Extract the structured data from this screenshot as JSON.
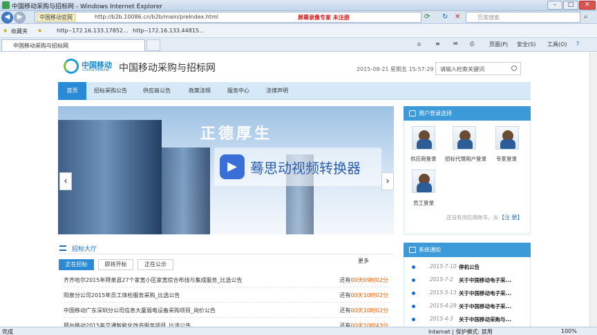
{
  "window": {
    "title": "中国移动采购与招标网 - Windows Internet Explorer"
  },
  "address": {
    "site_badge": "中国移动官网",
    "url": "http://b2b.10086.cn/b2b/main/preIndex.html",
    "recorder": "屏幕录像专家 未注册",
    "search_placeholder": "百度搜索"
  },
  "favorites": {
    "label": "收藏夹",
    "items": [
      "http--172.16.133.17852...",
      "http--172.16.133.44815..."
    ]
  },
  "tab": {
    "label": "中国移动采购与招标网"
  },
  "toolbar": {
    "page": "页面(P)",
    "safety": "安全(S)",
    "tools": "工具(O)",
    "help": "?"
  },
  "site": {
    "brand_cn": "中国移动",
    "brand_en": "China Mobile",
    "title": "中国移动采购与招标网",
    "datetime": "2015-08-21 星期五 15:57:29",
    "search_placeholder": "请输入检索关键词"
  },
  "nav": [
    "首页",
    "招标采购公告",
    "供应商公告",
    "政策法规",
    "服务中心",
    "法律声明"
  ],
  "banner": {
    "calligraphy": "正德厚生",
    "watermark": "蓦思动视频转换器",
    "prev": "‹",
    "next": "›"
  },
  "login": {
    "title": "用户登录选择",
    "roles": [
      "供应商登录",
      "招标代理用户登录",
      "专家登录",
      "员工登录"
    ],
    "hint": "还没有供应商账号，去",
    "register": "【注 册】"
  },
  "hall": {
    "title": "招标大厅",
    "tabs": [
      "正在招标",
      "即将开标",
      "正在公示"
    ],
    "more": "更多",
    "rows": [
      {
        "title": "齐齐哈尔2015年拜泉县27个家宽小区家宽综合布线与集成服务_比选公告",
        "prefix": "还有",
        "remain": "00天09时02分"
      },
      {
        "title": "阳泉分公司2015年员工体检服务采购_比选公告",
        "prefix": "还有",
        "remain": "00天10时02分"
      },
      {
        "title": "中国移动广东深圳分公司信息大厦弱电设备采购项目_询价公告",
        "prefix": "还有",
        "remain": "00天10时02分"
      },
      {
        "title": "邢台移动2015年交通智能化改造服务项目_比选公告",
        "prefix": "还有",
        "remain": "00天10时43分"
      }
    ]
  },
  "notice": {
    "title": "系统通知",
    "items": [
      {
        "date": "2015-7-10",
        "text": "停机公告"
      },
      {
        "date": "2015-7-2",
        "text": "关于中国移动电子采..."
      },
      {
        "date": "2015-5-13",
        "text": "关于中国移动电子采..."
      },
      {
        "date": "2015-4-29",
        "text": "关于中国移动电子采..."
      },
      {
        "date": "2015-4-3",
        "text": "关于中国移动采购与..."
      }
    ]
  },
  "status": {
    "left": "完成",
    "zone": "Internet | 保护模式: 禁用",
    "zoom": "100%"
  }
}
